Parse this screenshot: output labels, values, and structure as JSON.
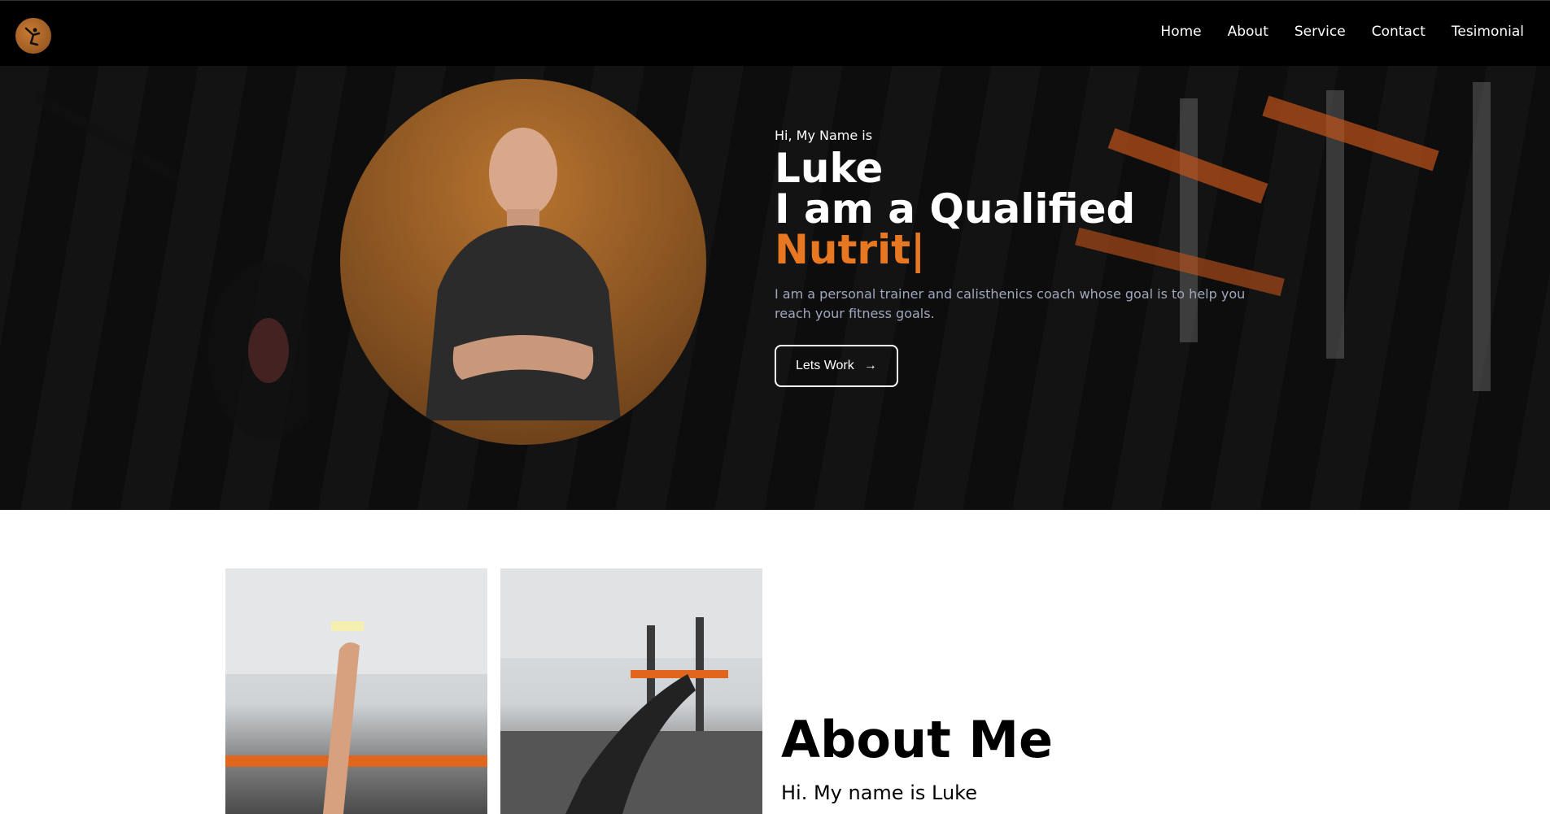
{
  "header": {
    "logo_icon": "gymnast-logo-icon",
    "nav": [
      "Home",
      "About",
      "Service",
      "Contact",
      "Tesimonial"
    ]
  },
  "hero": {
    "greeting": "Hi, My Name is",
    "name": "Luke",
    "line2": "I am a Qualified",
    "role_typing": "Nutrit|",
    "description": "I am a personal trainer and calisthenics coach whose goal is to help you reach your fitness goals.",
    "cta_label": "Lets Work",
    "cta_icon": "arrow-right-icon"
  },
  "about": {
    "title": "About Me",
    "subtitle": "Hi. My name is Luke"
  },
  "colors": {
    "accent": "#e87722",
    "nav_bg": "#000000",
    "desc_text": "#a0a7bd"
  }
}
